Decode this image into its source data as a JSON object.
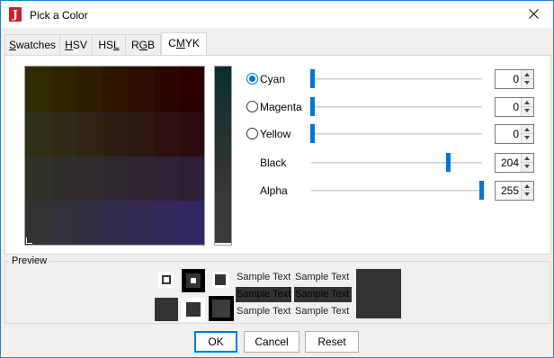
{
  "window": {
    "title": "Pick a Color",
    "app_icon_letter": "J"
  },
  "tabs": [
    {
      "label": "Swatches",
      "mnemonic": "S",
      "rest": "watches",
      "active": false
    },
    {
      "label": "HSV",
      "mnemonic": "H",
      "rest": "SV",
      "active": false
    },
    {
      "label": "HSL",
      "pre": "HS",
      "mnemonic": "L",
      "active": false
    },
    {
      "label": "RGB",
      "pre": "R",
      "mnemonic": "G",
      "rest": "B",
      "active": false
    },
    {
      "label": "CMYK",
      "pre": "C",
      "mnemonic": "M",
      "rest": "YK",
      "active": true
    }
  ],
  "cmyk": {
    "cyan": {
      "label": "Cyan",
      "value": "0",
      "selected": true,
      "level": 0
    },
    "magenta": {
      "label": "Magenta",
      "value": "0",
      "selected": false,
      "level": 0
    },
    "yellow": {
      "label": "Yellow",
      "value": "0",
      "selected": false,
      "level": 0
    },
    "black": {
      "label": "Black",
      "value": "204",
      "level": 0.8
    },
    "alpha": {
      "label": "Alpha",
      "value": "255",
      "level": 1.0
    }
  },
  "preview": {
    "legend": "Preview",
    "sample_text": "Sample Text",
    "color": "#333333"
  },
  "buttons": {
    "ok": "OK",
    "cancel": "Cancel",
    "reset": "Reset"
  },
  "colors": {
    "accent": "#0078d7",
    "title_icon": "#c8202b"
  }
}
